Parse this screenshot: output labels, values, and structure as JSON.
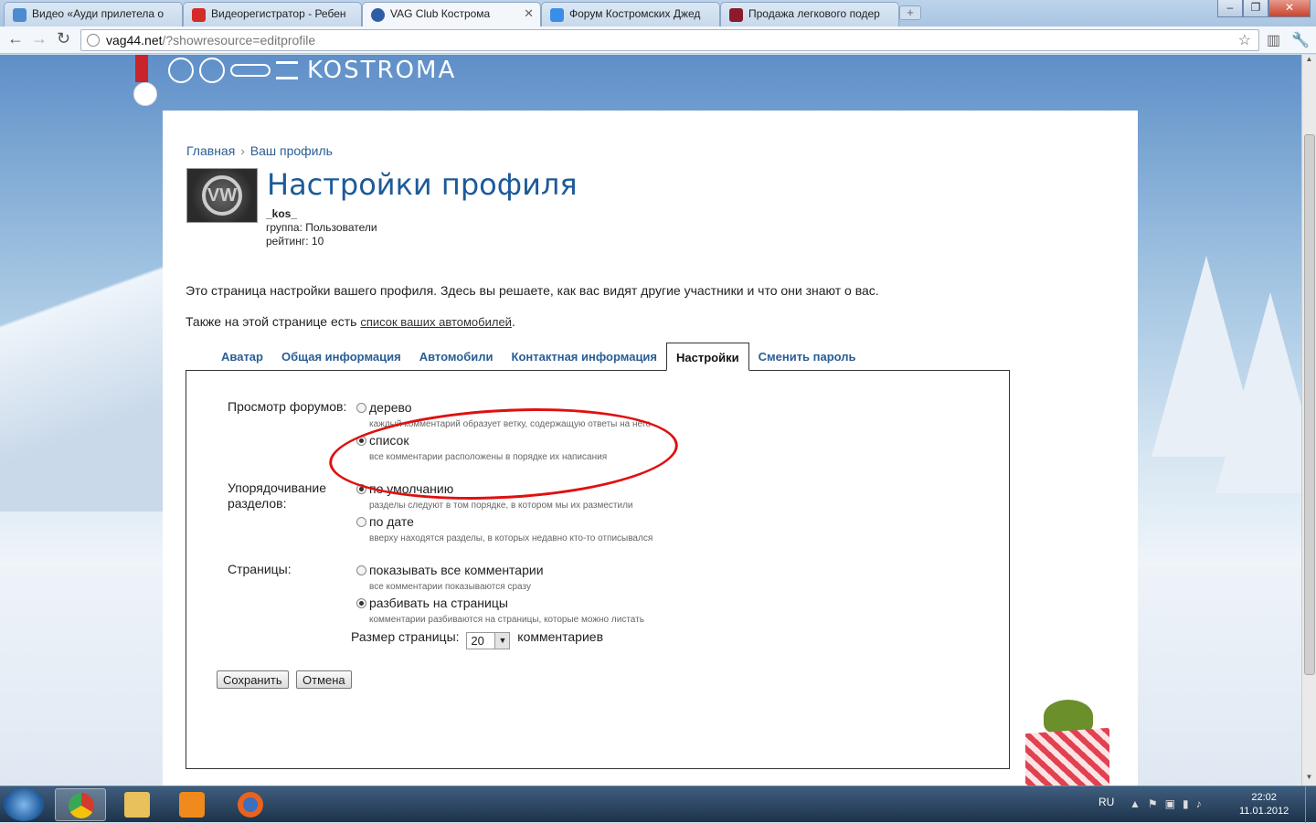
{
  "browser": {
    "tabs": [
      {
        "title": "Видео «Ауди прилетела о",
        "color": "#4d8bd1"
      },
      {
        "title": "Видеорегистратор - Ребен",
        "color": "#d42a2a"
      },
      {
        "title": "VAG Club Кострома",
        "color": "#2e5fa6"
      },
      {
        "title": "Форум Костромских Джед",
        "color": "#3a8ee6"
      },
      {
        "title": "Продажа легкового подер",
        "color": "#8b1a2c"
      }
    ],
    "new_tab": "+",
    "url_host": "vag44.net",
    "url_path": "/?showresource=editprofile"
  },
  "site": {
    "logo_text": "KOSTROMA"
  },
  "breadcrumb": {
    "home": "Главная",
    "separator": "›",
    "current": "Ваш профиль"
  },
  "profile": {
    "title": "Настройки профиля",
    "username": "_kos_",
    "group": "группа: Пользователи",
    "rating": "рейтинг: 10",
    "avatar_glyph": "VW"
  },
  "intro": {
    "line1": "Это страница настройки вашего профиля. Здесь вы решаете, как вас видят другие участники и что они знают о вас.",
    "line2_prefix": "Также на этой странице есть ",
    "line2_link": "список ваших автомобилей",
    "line2_suffix": "."
  },
  "tabs": [
    {
      "label": "Аватар",
      "active": false
    },
    {
      "label": "Общая информация",
      "active": false
    },
    {
      "label": "Автомобили",
      "active": false
    },
    {
      "label": "Контактная информация",
      "active": false
    },
    {
      "label": "Настройки",
      "active": true
    },
    {
      "label": "Сменить пароль",
      "active": false
    }
  ],
  "settings": {
    "forum_view": {
      "label": "Просмотр форумов:",
      "options": [
        {
          "label": "дерево",
          "hint": "каждый комментарий образует ветку, содержащую ответы на него",
          "selected": false
        },
        {
          "label": "список",
          "hint": "все комментарии расположены в порядке их написания",
          "selected": true
        }
      ]
    },
    "section_order": {
      "label": "Упорядочивание разделов:",
      "options": [
        {
          "label": "по умолчанию",
          "hint": "разделы следуют в том порядке, в котором мы их разместили",
          "selected": true
        },
        {
          "label": "по дате",
          "hint": "вверху находятся разделы, в которых недавно кто-то отписывался",
          "selected": false
        }
      ]
    },
    "pages": {
      "label": "Страницы:",
      "options": [
        {
          "label": "показывать все комментарии",
          "hint": "все комментарии показываются сразу",
          "selected": false
        },
        {
          "label": "разбивать на страницы",
          "hint": "комментарии разбиваются на страницы, которые можно листать",
          "selected": true
        }
      ]
    },
    "page_size": {
      "label": "Размер страницы:",
      "value": "20",
      "suffix": "комментариев"
    },
    "save": "Сохранить",
    "cancel": "Отмена"
  },
  "taskbar": {
    "lang": "RU",
    "time": "22:02",
    "date": "11.01.2012"
  },
  "colors": {
    "link": "#2a5d95",
    "title": "#1d5a9a",
    "highlight_oval": "#e01010"
  }
}
